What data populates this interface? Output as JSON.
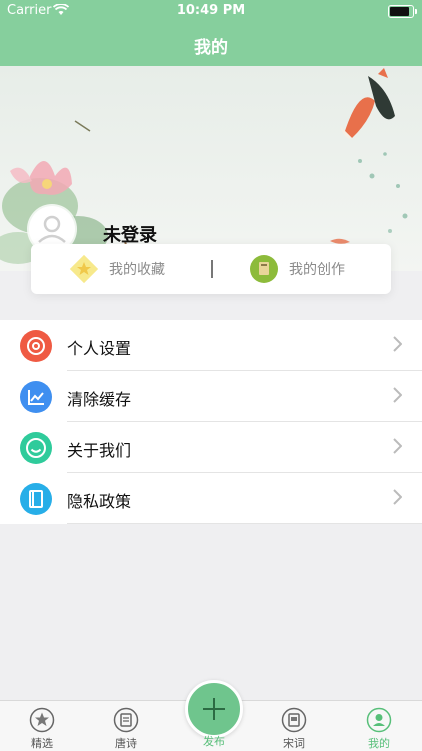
{
  "status_bar": {
    "carrier": "Carrier",
    "time": "10:49 PM"
  },
  "nav": {
    "title": "我的"
  },
  "profile": {
    "username": "未登录"
  },
  "quick_actions": [
    {
      "label": "我的收藏",
      "icon": "star-icon"
    },
    {
      "label": "我的创作",
      "icon": "book-icon"
    }
  ],
  "menu": [
    {
      "label": "个人设置",
      "icon": "gear-icon",
      "color": "#ef5a43"
    },
    {
      "label": "清除缓存",
      "icon": "chart-icon",
      "color": "#3f8ff0"
    },
    {
      "label": "关于我们",
      "icon": "smile-icon",
      "color": "#2fcb9b"
    },
    {
      "label": "隐私政策",
      "icon": "document-icon",
      "color": "#27aee8"
    }
  ],
  "tabbar": {
    "tabs": [
      {
        "label": "精选",
        "icon": "star-icon"
      },
      {
        "label": "唐诗",
        "icon": "scroll-icon"
      },
      {
        "label": "发布",
        "icon": "plus-icon"
      },
      {
        "label": "宋词",
        "icon": "book-icon"
      },
      {
        "label": "我的",
        "icon": "user-icon"
      }
    ],
    "active": "我的",
    "accent": "#57bf79"
  },
  "colors": {
    "nav_bg": "#86cf9d",
    "page_bg": "#efeff1"
  }
}
